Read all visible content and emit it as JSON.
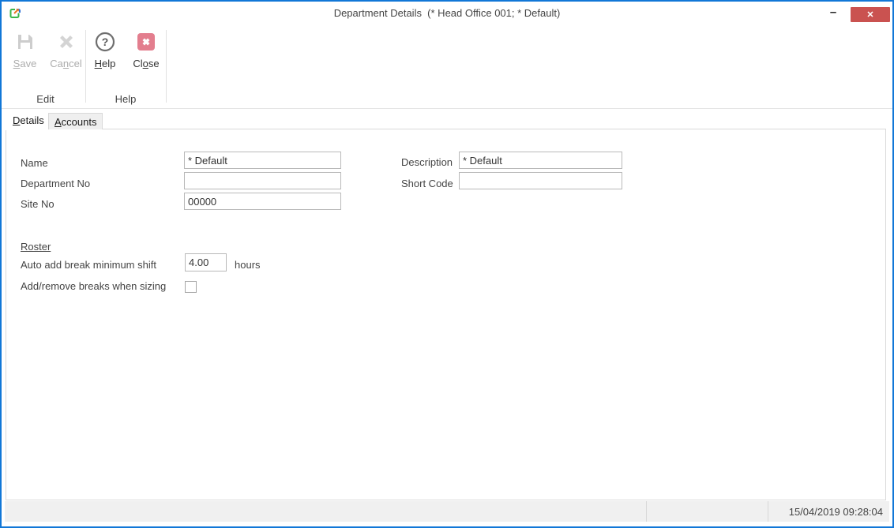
{
  "window": {
    "title": "Department Details  (* Head Office 001; * Default)",
    "minimize_label": "–",
    "close_label": "✕"
  },
  "icons": {
    "app": "app-launch-icon",
    "save": "floppy-disk-icon",
    "cancel": "gray-x-icon",
    "help": "question-circle-icon",
    "close": "red-x-box-icon",
    "minimize": "minimize-icon",
    "window_close": "close-icon"
  },
  "colors": {
    "window_border": "#1177d7",
    "titlebar_close_bg": "#ca5250",
    "ribbon_close_icon": "#e37e8e",
    "status_bar_bg": "#f0f0f0"
  },
  "ribbon": {
    "buttons": {
      "save": {
        "pre": "",
        "accel": "S",
        "post": "ave"
      },
      "cancel": {
        "pre": "Ca",
        "accel": "n",
        "post": "cel"
      },
      "help": {
        "pre": "",
        "accel": "H",
        "post": "elp"
      },
      "close": {
        "pre": "Cl",
        "accel": "o",
        "post": "se"
      }
    },
    "groups": {
      "edit": "Edit",
      "help": "Help"
    }
  },
  "tabs": {
    "details": {
      "pre": "",
      "accel": "D",
      "post": "etails"
    },
    "accounts": {
      "pre": "",
      "accel": "A",
      "post": "ccounts"
    }
  },
  "form": {
    "name_label": "Name",
    "name_value": "* Default",
    "department_no_label": "Department No",
    "department_no_value": "",
    "site_no_label": "Site No",
    "site_no_value": "00000",
    "description_label": "Description",
    "description_value": "* Default",
    "short_code_label": "Short Code",
    "short_code_value": "",
    "roster": {
      "heading": "Roster",
      "auto_add_label": "Auto add break minimum shift",
      "auto_add_value": "4.00",
      "auto_add_unit": "hours",
      "add_remove_label": "Add/remove breaks when sizing",
      "add_remove_checked": false
    }
  },
  "status_bar": {
    "datetime": "15/04/2019 09:28:04"
  }
}
